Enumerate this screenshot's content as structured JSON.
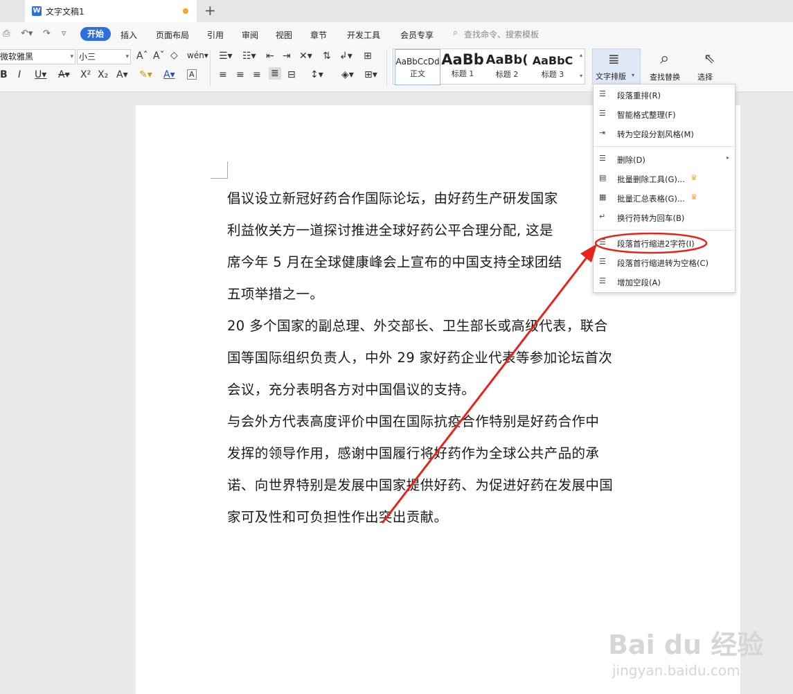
{
  "titlebar": {
    "tab_title": "文字文稿1",
    "new_tab": "+"
  },
  "menu": {
    "items": [
      "开始",
      "插入",
      "页面布局",
      "引用",
      "审阅",
      "视图",
      "章节",
      "开发工具",
      "会员专享"
    ],
    "search_placeholder": "查找命令、搜索模板"
  },
  "ribbon": {
    "font_name": "微软雅黑",
    "font_size": "小三",
    "styles": [
      {
        "sample": "AaBbCcDd",
        "name": "正文"
      },
      {
        "sample": "AaBb",
        "name": "标题 1"
      },
      {
        "sample": "AaBb(",
        "name": "标题 2"
      },
      {
        "sample": "AaBbC",
        "name": "标题 3"
      }
    ],
    "typeset_label": "文字排版",
    "find_replace_label": "查找替换",
    "select_label": "选择"
  },
  "document": {
    "lines": [
      "倡议设立新冠好药合作国际论坛，由好药生产研发国家",
      "利益攸关方一道探讨推进全球好药公平合理分配, 这是",
      "席今年 5 月在全球健康峰会上宣布的中国支持全球团结",
      "五项举措之一。",
      "20 多个国家的副总理、外交部长、卫生部长或高级代表，联合",
      "国等国际组织负责人，中外 29 家好药企业代表等参加论坛首次",
      "会议，充分表明各方对中国倡议的支持。",
      "与会外方代表高度评价中国在国际抗疫合作特别是好药合作中",
      "发挥的领导作用，感谢中国履行将好药作为全球公共产品的承",
      "诺、向世界特别是发展中国家提供好药、为促进好药在发展中国",
      "家可及性和可负担性作出突出贡献。"
    ]
  },
  "dropdown": {
    "items": [
      {
        "label": "段落重排(R)",
        "icon": "paragraph-rearrange-icon"
      },
      {
        "label": "智能格式整理(F)",
        "icon": "smart-format-icon"
      },
      {
        "label": "转为空段分割风格(M)",
        "icon": "empty-para-split-icon"
      },
      {
        "label": "删除(D)",
        "icon": "delete-icon"
      },
      {
        "label": "批量删除工具(G)...",
        "icon": "batch-delete-icon"
      },
      {
        "label": "批量汇总表格(G)...",
        "icon": "batch-table-icon"
      },
      {
        "label": "换行符转为回车(B)",
        "icon": "linebreak-icon"
      },
      {
        "label": "段落首行缩进2字符(I)",
        "icon": "indent-2char-icon"
      },
      {
        "label": "段落首行缩进转为空格(C)",
        "icon": "indent-to-space-icon"
      },
      {
        "label": "增加空段(A)",
        "icon": "add-empty-para-icon"
      }
    ]
  },
  "watermark": {
    "brand": "Bai du 经验",
    "url": "jingyan.baidu.com"
  },
  "colors": {
    "accent": "#2f6fdb",
    "annotation": "#e8231a",
    "crown": "#f0a030"
  }
}
